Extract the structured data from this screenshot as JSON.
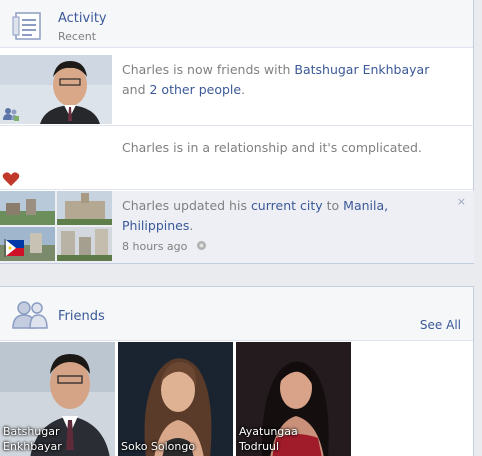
{
  "activity": {
    "title": "Activity",
    "subtitle": "Recent",
    "stories": [
      {
        "text_before": "Charles is now friends with ",
        "link1": "Batshugar Enkhbayar",
        "text_mid": "and ",
        "link2": "2 other people",
        "text_end": "."
      },
      {
        "text": "Charles is in a relationship and it's complicated."
      },
      {
        "text_before": "Charles updated his ",
        "link1": "current city",
        "text_mid": " to ",
        "link2": "Manila,",
        "link3": "Philippines",
        "text_end": ".",
        "time": "8 hours ago",
        "close": "×"
      }
    ]
  },
  "friends": {
    "title": "Friends",
    "see_all": "See All",
    "items": [
      {
        "name_line1": "Batshugar",
        "name_line2": "Enkhbayar"
      },
      {
        "name_line1": "",
        "name_line2": "Soko Solongo"
      },
      {
        "name_line1": "Ayatungaa",
        "name_line2": "Todruul"
      }
    ]
  },
  "colors": {
    "link": "#3b5998",
    "text": "#808080",
    "highlight_bg": "#edeff4"
  },
  "icons": [
    "activity-list-icon",
    "friends-badge-icon",
    "heart-icon",
    "philippines-flag-icon",
    "clock-globe-icon",
    "friends-people-icon"
  ]
}
